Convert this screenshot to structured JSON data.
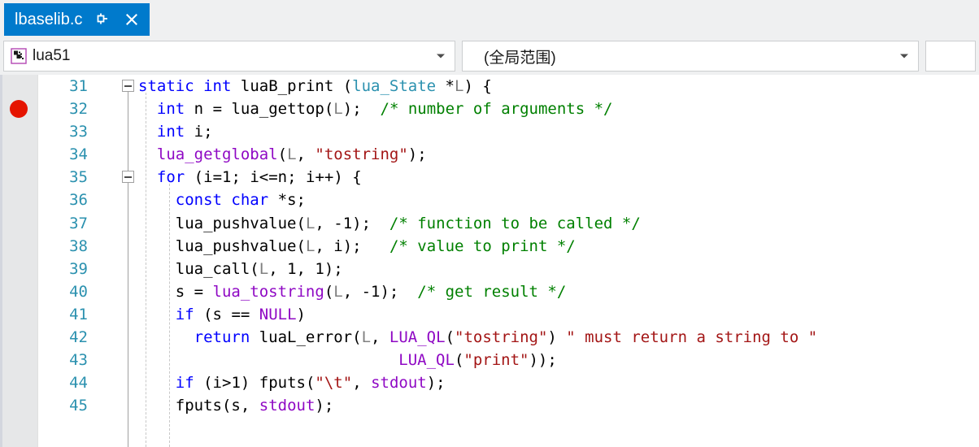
{
  "window": {
    "tab": {
      "title": "lbaselib.c",
      "pin_icon": "pin-icon",
      "close_icon": "close-icon"
    }
  },
  "navbar": {
    "project_combo": {
      "icon": "project-icon",
      "value": "lua51",
      "arrow_icon": "chevron-down-icon"
    },
    "scope_combo": {
      "value": "(全局范围)",
      "arrow_icon": "chevron-down-icon"
    },
    "member_combo": {
      "value": ""
    }
  },
  "editor": {
    "breakpoint_line": 32,
    "colors": {
      "keyword": "#0000ff",
      "type": "#2b91af",
      "macro": "#8f08c4",
      "string": "#a31515",
      "comment": "#008000",
      "identifier": "#808080",
      "line_number": "#2b91af",
      "breakpoint": "#e51400",
      "tab_background": "#007acc",
      "chrome_background": "#eff0f1"
    },
    "lines": [
      {
        "num": "31",
        "text": "static int luaB_print (lua_State *L) {"
      },
      {
        "num": "32",
        "text": "  int n = lua_gettop(L);  /* number of arguments */"
      },
      {
        "num": "33",
        "text": "  int i;"
      },
      {
        "num": "34",
        "text": "  lua_getglobal(L, \"tostring\");"
      },
      {
        "num": "35",
        "text": "  for (i=1; i<=n; i++) {"
      },
      {
        "num": "36",
        "text": "    const char *s;"
      },
      {
        "num": "37",
        "text": "    lua_pushvalue(L, -1);  /* function to be called */"
      },
      {
        "num": "38",
        "text": "    lua_pushvalue(L, i);   /* value to print */"
      },
      {
        "num": "39",
        "text": "    lua_call(L, 1, 1);"
      },
      {
        "num": "40",
        "text": "    s = lua_tostring(L, -1);  /* get result */"
      },
      {
        "num": "41",
        "text": "    if (s == NULL)"
      },
      {
        "num": "42",
        "text": "      return luaL_error(L, LUA_QL(\"tostring\") \" must return a string to \""
      },
      {
        "num": "43",
        "text": "                            LUA_QL(\"print\"));"
      },
      {
        "num": "44",
        "text": "    if (i>1) fputs(\"\\t\", stdout);"
      },
      {
        "num": "45",
        "text": "    fputs(s, stdout);"
      }
    ]
  }
}
